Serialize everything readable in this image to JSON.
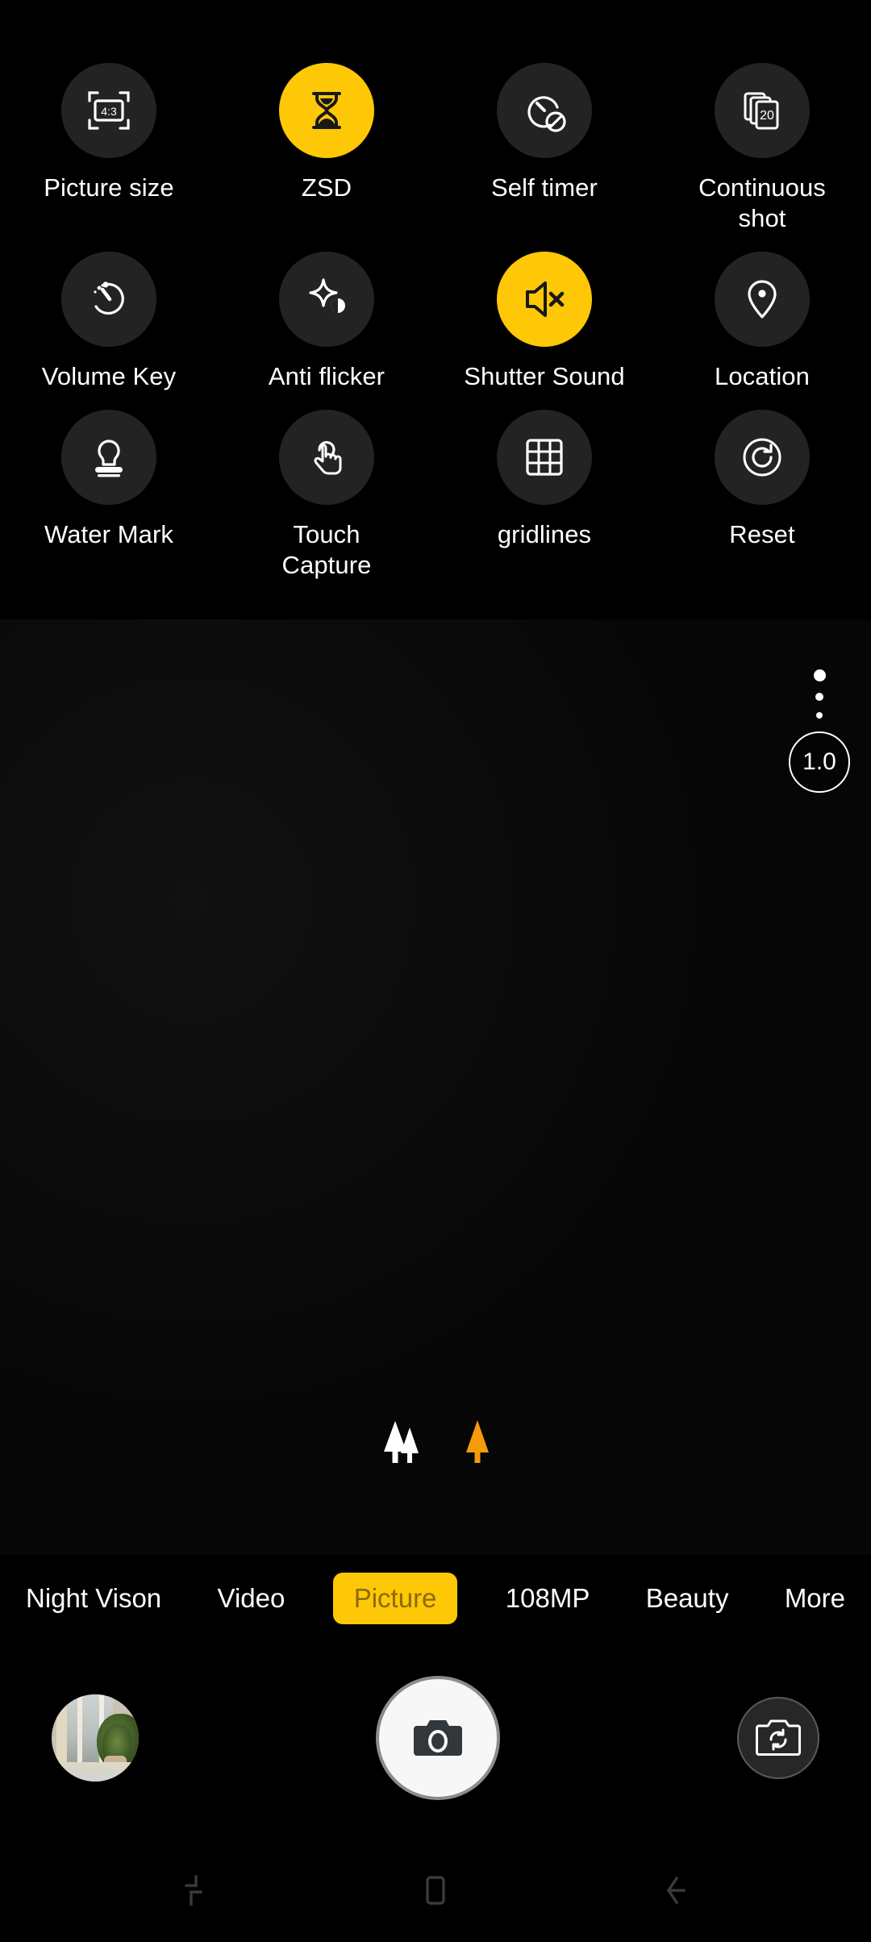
{
  "theme": {
    "background": "#000000",
    "accent": "#FFC806",
    "icon_circle": "#232323",
    "icon_stroke": "#FFFFFF",
    "selected_mode_text": "#8A6A08"
  },
  "settings_panel": {
    "rows": [
      [
        {
          "label": "Picture size",
          "icon": "picture-size-icon",
          "badge": "4:3",
          "active": false
        },
        {
          "label": "ZSD",
          "icon": "hourglass-icon",
          "badge": "",
          "active": true
        },
        {
          "label": "Self timer",
          "icon": "self-timer-off-icon",
          "badge": "",
          "active": false
        },
        {
          "label": "Continuous shot",
          "icon": "continuous-shot-icon",
          "badge": "20",
          "active": false
        }
      ],
      [
        {
          "label": "Volume Key",
          "icon": "volume-key-dial-icon",
          "badge": "",
          "active": false
        },
        {
          "label": "Anti flicker",
          "icon": "anti-flicker-icon",
          "badge": "",
          "active": false
        },
        {
          "label": "Shutter Sound",
          "icon": "speaker-mute-icon",
          "badge": "",
          "active": true
        },
        {
          "label": "Location",
          "icon": "location-pin-icon",
          "badge": "",
          "active": false
        }
      ],
      [
        {
          "label": "Water Mark",
          "icon": "watermark-stamp-icon",
          "badge": "",
          "active": false
        },
        {
          "label": "Touch Capture",
          "icon": "touch-capture-hand-icon",
          "badge": "",
          "active": false
        },
        {
          "label": "gridlines",
          "icon": "grid-3x3-icon",
          "badge": "",
          "active": false
        },
        {
          "label": "Reset",
          "icon": "reset-refresh-icon",
          "badge": "",
          "active": false
        }
      ]
    ]
  },
  "viewfinder": {
    "zoom_level": "1.0",
    "zoom_dots": 3,
    "scene_icons": [
      {
        "name": "trees-white-icon",
        "color": "#FFFFFF"
      },
      {
        "name": "tree-orange-icon",
        "color": "#F59A0B"
      }
    ]
  },
  "mode_bar": {
    "modes": [
      {
        "label": "Night Vison",
        "selected": false
      },
      {
        "label": "Video",
        "selected": false
      },
      {
        "label": "Picture",
        "selected": true
      },
      {
        "label": "108MP",
        "selected": false
      },
      {
        "label": "Beauty",
        "selected": false
      },
      {
        "label": "More",
        "selected": false
      }
    ]
  },
  "shutter_bar": {
    "gallery_thumb_name": "gallery-thumbnail",
    "shutter_icon": "camera-icon",
    "switch_camera_icon": "switch-camera-icon"
  },
  "nav_bar": {
    "buttons": [
      {
        "name": "recents-icon"
      },
      {
        "name": "home-icon"
      },
      {
        "name": "back-icon"
      }
    ]
  }
}
